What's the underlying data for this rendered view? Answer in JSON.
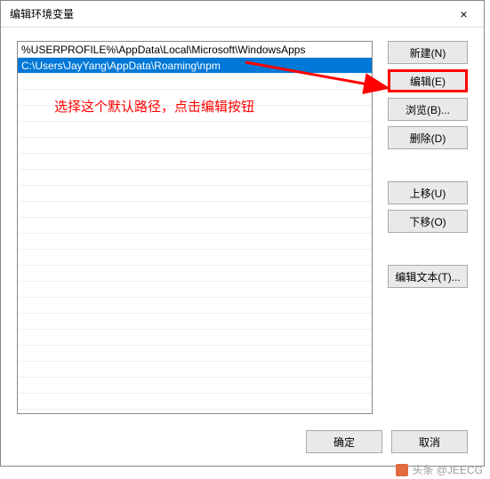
{
  "dialog": {
    "title": "编辑环境变量",
    "close": "×"
  },
  "list": {
    "items": [
      "%USERPROFILE%\\AppData\\Local\\Microsoft\\WindowsApps",
      "C:\\Users\\JayYang\\AppData\\Roaming\\npm"
    ],
    "selected_index": 1
  },
  "buttons": {
    "new": "新建(N)",
    "edit": "编辑(E)",
    "browse": "浏览(B)...",
    "delete": "删除(D)",
    "moveup": "上移(U)",
    "movedown": "下移(O)",
    "edittext": "编辑文本(T)..."
  },
  "footer": {
    "ok": "确定",
    "cancel": "取消"
  },
  "annotation": {
    "text": "选择这个默认路径，点击编辑按钮"
  },
  "watermark": {
    "text": "头条 @JEECG"
  }
}
